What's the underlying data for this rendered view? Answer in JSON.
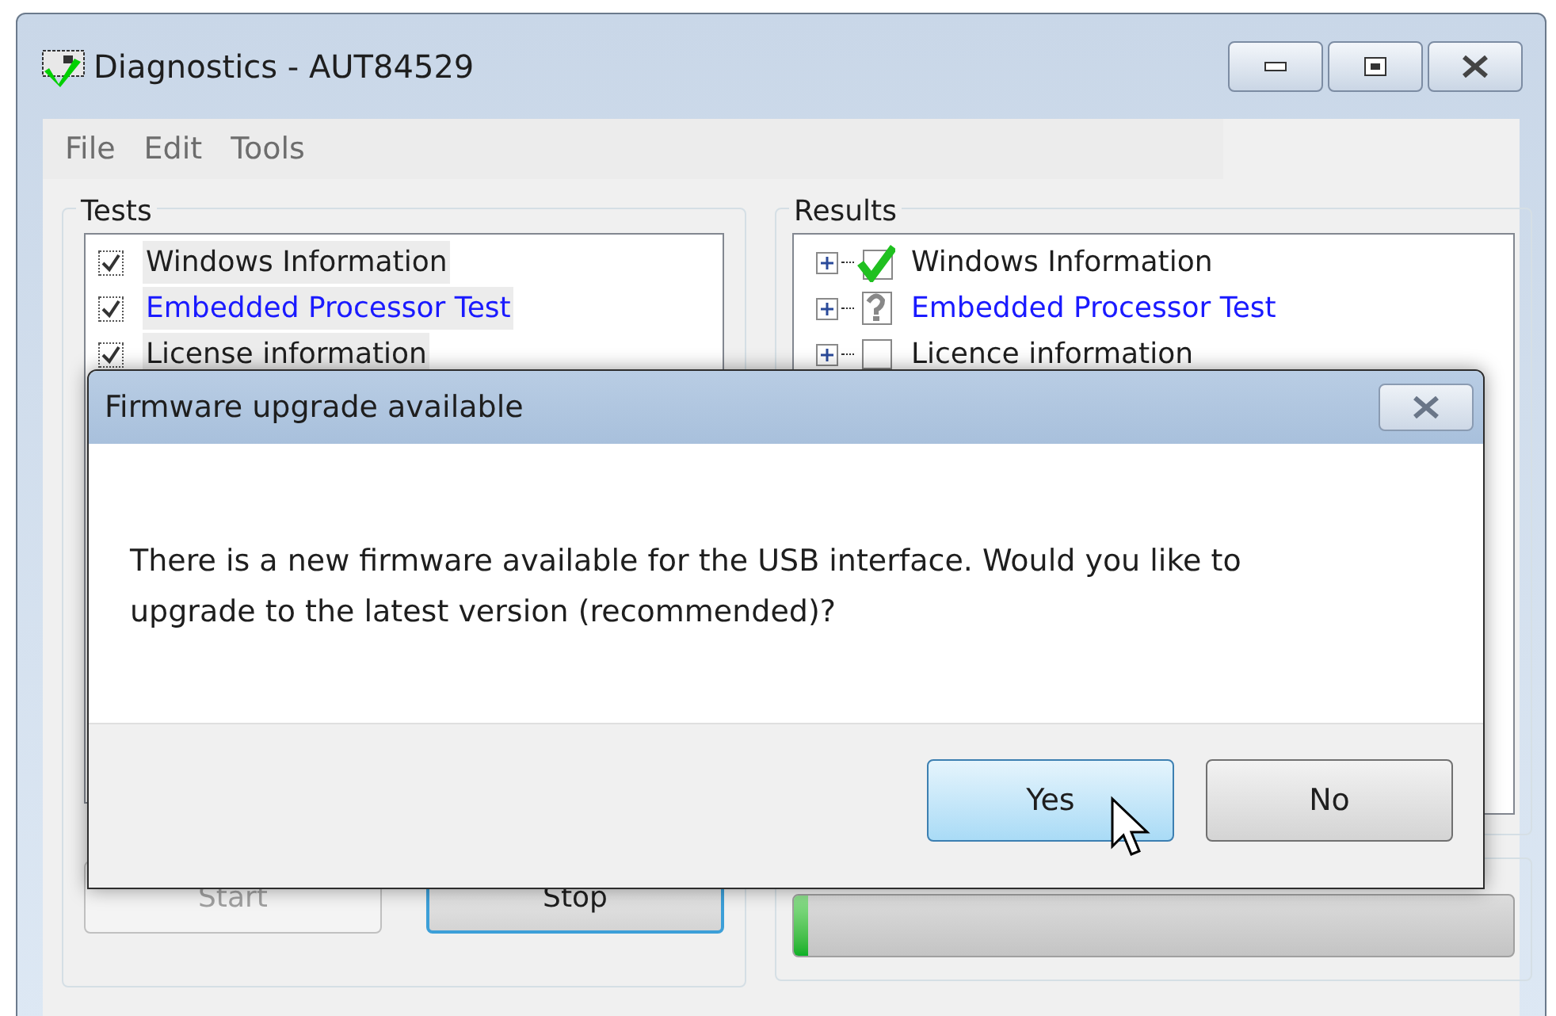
{
  "window": {
    "title": "Diagnostics - AUT84529"
  },
  "menu": [
    "File",
    "Edit",
    "Tools"
  ],
  "tests": {
    "title": "Tests",
    "items": [
      {
        "label": "Windows Information",
        "checked": true,
        "selected": false
      },
      {
        "label": "Embedded Processor Test",
        "checked": true,
        "selected": true
      },
      {
        "label": "License information",
        "checked": true,
        "selected": false
      }
    ]
  },
  "buttons": [
    {
      "label": "Start",
      "disabled": true,
      "focused": false
    },
    {
      "label": "Stop",
      "disabled": false,
      "focused": true
    }
  ],
  "results": {
    "title": "Results",
    "items": [
      {
        "label": "Windows Information",
        "kind": "passed",
        "selected": false
      },
      {
        "label": "Embedded Processor Test",
        "kind": "unknown",
        "selected": true
      },
      {
        "label": "Licence information",
        "kind": "empty",
        "selected": false
      }
    ]
  },
  "progress": {
    "level": 0.02
  },
  "dialog": {
    "title": "Firmware upgrade available",
    "message": "There is a new firmware available for the USB interface. Would you like to upgrade to the latest version (recommended)?",
    "buttons": [
      {
        "label": "Yes",
        "focused": true
      },
      {
        "label": "No",
        "focused": false
      }
    ]
  }
}
